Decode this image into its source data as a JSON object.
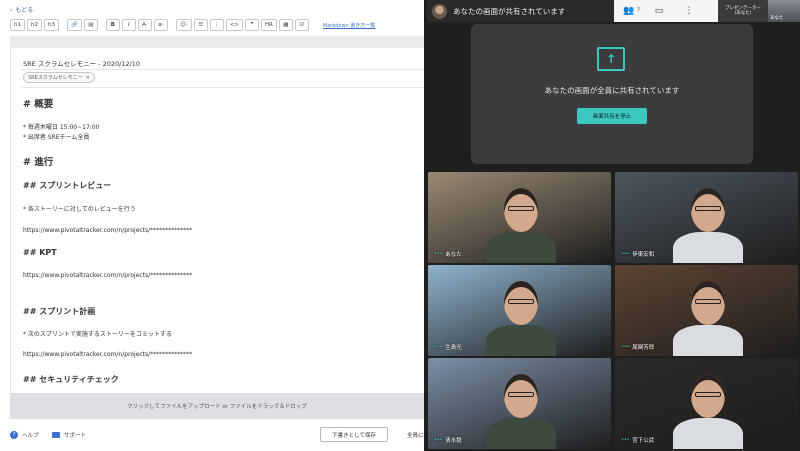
{
  "editor": {
    "back_label": "もどる",
    "toolbar": {
      "buttons": [
        "h1",
        "h2",
        "h3",
        "🔗",
        "▤",
        "B",
        "I",
        "A·",
        "≡·",
        "☺·",
        "☰",
        "⋮",
        "<>",
        "❞",
        "HR",
        "▦",
        "☑"
      ],
      "markdown_link": "Markdown 書き方一覧"
    },
    "title": "SRE スクラムセレモニー - 2020/12/10",
    "tag": "SREスクラムセレモニー",
    "tag_close": "×",
    "lines": [
      {
        "text": "# 概要",
        "style": "h1"
      },
      {
        "text": "* 毎週木曜日 15:00~17:00",
        "style": "p"
      },
      {
        "text": "* 出席者 SREチーム全員",
        "style": "p"
      },
      {
        "text": "# 進行",
        "style": "h1"
      },
      {
        "text": "## スプリントレビュー",
        "style": "h2"
      },
      {
        "text": "* 各ストーリーに対してのレビューを行う",
        "style": "p"
      },
      {
        "text": "https://www.pivotaltracker.com/n/projects/**************",
        "style": "p"
      },
      {
        "text": "## KPT",
        "style": "h2"
      },
      {
        "text": "https://www.pivotaltracker.com/n/projects/**************",
        "style": "p"
      },
      {
        "text": "## スプリント計画",
        "style": "h2"
      },
      {
        "text": "* 次のスプリントで実施するストーリーをコミットする",
        "style": "p"
      },
      {
        "text": "https://www.pivotaltracker.com/n/projects/**************",
        "style": "p"
      },
      {
        "text": "## セキュリティチェック",
        "style": "h2"
      }
    ],
    "upload_text": "クリックしてファイルをアップロード or ファイルをドラッグ＆ドロップ",
    "footer": {
      "help": "ヘルプ",
      "support": "サポート",
      "save_draft": "下書きとして保存",
      "all": "全員に"
    }
  },
  "meeting": {
    "title": "あなたの画面が共有されています",
    "participants_count": "7",
    "presenter_label_line1": "プレゼンテーター",
    "presenter_label_line2": "(あなた)",
    "presenter_name": "あなた",
    "share_message": "あなたの画面が全員に共有されています",
    "stop_share_label": "画面共有を停止",
    "participants": [
      {
        "name": "あなた",
        "bg": "#9a8a74"
      },
      {
        "name": "伊東宏和",
        "bg": "#4d5660"
      },
      {
        "name": "生島光",
        "bg": "#8fb3cf"
      },
      {
        "name": "尾関芳郎",
        "bg": "#5d4433"
      },
      {
        "name": "清水毅",
        "bg": "#7c8fa8"
      },
      {
        "name": "宮下公武",
        "bg": "#2c2a28"
      }
    ],
    "accent_color": "#3cc8c0"
  }
}
